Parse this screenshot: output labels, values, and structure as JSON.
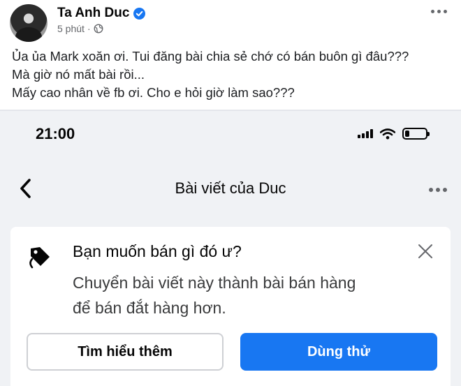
{
  "post": {
    "author": "Ta Anh Duc",
    "time": "5 phút",
    "separator": "·",
    "lines": [
      "Ủa ủa Mark xoăn ơi. Tui đăng bài chia sẻ chớ có bán buôn gì đâu???",
      "Mà giờ nó mất bài rồi...",
      "Mấy cao nhân về fb ơi. Cho e hỏi giờ làm sao???"
    ]
  },
  "phone": {
    "status_time": "21:00",
    "battery_level_fraction": 0.2,
    "nav_title": "Bài viết của Duc",
    "prompt": {
      "title": "Bạn muốn bán gì đó ư?",
      "description": [
        "Chuyển bài viết này thành bài bán hàng",
        "để bán đắt hàng hơn."
      ],
      "learn_more_label": "Tìm hiểu thêm",
      "try_label": "Dùng thử"
    }
  },
  "icons": {
    "verified": "verified-badge-icon",
    "privacy": "globe-icon",
    "more": "more-horizontal-icon",
    "back": "chevron-left-icon",
    "tag": "price-tag-icon",
    "close": "close-icon"
  },
  "colors": {
    "brand_blue": "#1877f2",
    "secondary_text": "#65676b",
    "phone_background": "#f0f2f5"
  }
}
